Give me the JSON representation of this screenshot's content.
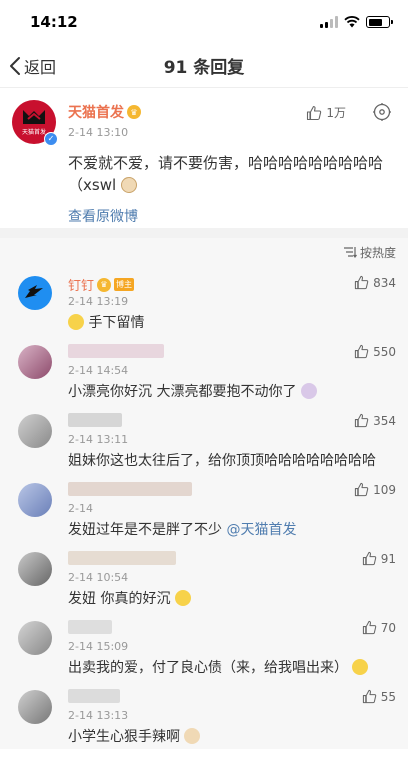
{
  "status_bar": {
    "time": "14:12"
  },
  "nav": {
    "back_label": "返回",
    "title": "91 条回复"
  },
  "post": {
    "author": "天猫首发",
    "time": "2-14 13:10",
    "likes": "1万",
    "text": "不爱就不爱，请不要伤害，哈哈哈哈哈哈哈哈哈（xswl",
    "source_link": "查看原微博",
    "avatar_text": "天猫首发"
  },
  "sort": {
    "label": "按热度"
  },
  "comments": [
    {
      "name": "钉钉",
      "tag": "博主",
      "time": "2-14 13:19",
      "text": "手下留情",
      "likes": "834"
    },
    {
      "name": "",
      "time": "2-14 14:54",
      "text": "小漂亮你好沉 大漂亮都要抱不动你了",
      "likes": "550"
    },
    {
      "name": "",
      "time": "2-14 13:11",
      "text": "姐妹你这也太往后了，给你顶顶哈哈哈哈哈哈哈哈",
      "likes": "354"
    },
    {
      "name": "",
      "time": "2-14 ",
      "text_before": "发妞过年是不是胖了不少",
      "mention": "@天猫首发",
      "likes": "109"
    },
    {
      "name": "",
      "time": "2-14 10:54",
      "text": "发妞 你真的好沉",
      "likes": "91"
    },
    {
      "name": "",
      "time": "2-14 15:09",
      "text": "出卖我的爱，付了良心债（来，给我唱出来）",
      "likes": "70"
    },
    {
      "name": "",
      "time": "2-14 13:13",
      "text": "小学生心狠手辣啊",
      "likes": "55"
    }
  ],
  "colors": {
    "accent_name": "#eb7350",
    "link": "#507daf",
    "verify": "#3c8df0"
  }
}
